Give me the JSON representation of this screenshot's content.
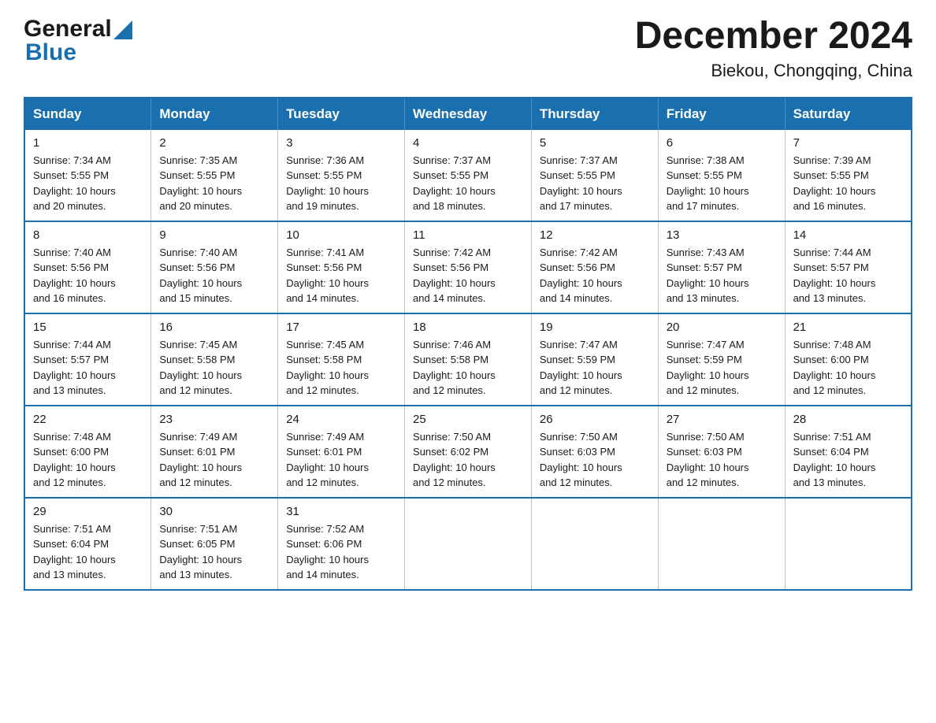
{
  "header": {
    "logo_general": "General",
    "logo_blue": "Blue",
    "month_title": "December 2024",
    "location": "Biekou, Chongqing, China"
  },
  "weekdays": [
    "Sunday",
    "Monday",
    "Tuesday",
    "Wednesday",
    "Thursday",
    "Friday",
    "Saturday"
  ],
  "weeks": [
    [
      {
        "day": "1",
        "sunrise": "7:34 AM",
        "sunset": "5:55 PM",
        "daylight": "10 hours and 20 minutes."
      },
      {
        "day": "2",
        "sunrise": "7:35 AM",
        "sunset": "5:55 PM",
        "daylight": "10 hours and 20 minutes."
      },
      {
        "day": "3",
        "sunrise": "7:36 AM",
        "sunset": "5:55 PM",
        "daylight": "10 hours and 19 minutes."
      },
      {
        "day": "4",
        "sunrise": "7:37 AM",
        "sunset": "5:55 PM",
        "daylight": "10 hours and 18 minutes."
      },
      {
        "day": "5",
        "sunrise": "7:37 AM",
        "sunset": "5:55 PM",
        "daylight": "10 hours and 17 minutes."
      },
      {
        "day": "6",
        "sunrise": "7:38 AM",
        "sunset": "5:55 PM",
        "daylight": "10 hours and 17 minutes."
      },
      {
        "day": "7",
        "sunrise": "7:39 AM",
        "sunset": "5:55 PM",
        "daylight": "10 hours and 16 minutes."
      }
    ],
    [
      {
        "day": "8",
        "sunrise": "7:40 AM",
        "sunset": "5:56 PM",
        "daylight": "10 hours and 16 minutes."
      },
      {
        "day": "9",
        "sunrise": "7:40 AM",
        "sunset": "5:56 PM",
        "daylight": "10 hours and 15 minutes."
      },
      {
        "day": "10",
        "sunrise": "7:41 AM",
        "sunset": "5:56 PM",
        "daylight": "10 hours and 14 minutes."
      },
      {
        "day": "11",
        "sunrise": "7:42 AM",
        "sunset": "5:56 PM",
        "daylight": "10 hours and 14 minutes."
      },
      {
        "day": "12",
        "sunrise": "7:42 AM",
        "sunset": "5:56 PM",
        "daylight": "10 hours and 14 minutes."
      },
      {
        "day": "13",
        "sunrise": "7:43 AM",
        "sunset": "5:57 PM",
        "daylight": "10 hours and 13 minutes."
      },
      {
        "day": "14",
        "sunrise": "7:44 AM",
        "sunset": "5:57 PM",
        "daylight": "10 hours and 13 minutes."
      }
    ],
    [
      {
        "day": "15",
        "sunrise": "7:44 AM",
        "sunset": "5:57 PM",
        "daylight": "10 hours and 13 minutes."
      },
      {
        "day": "16",
        "sunrise": "7:45 AM",
        "sunset": "5:58 PM",
        "daylight": "10 hours and 12 minutes."
      },
      {
        "day": "17",
        "sunrise": "7:45 AM",
        "sunset": "5:58 PM",
        "daylight": "10 hours and 12 minutes."
      },
      {
        "day": "18",
        "sunrise": "7:46 AM",
        "sunset": "5:58 PM",
        "daylight": "10 hours and 12 minutes."
      },
      {
        "day": "19",
        "sunrise": "7:47 AM",
        "sunset": "5:59 PM",
        "daylight": "10 hours and 12 minutes."
      },
      {
        "day": "20",
        "sunrise": "7:47 AM",
        "sunset": "5:59 PM",
        "daylight": "10 hours and 12 minutes."
      },
      {
        "day": "21",
        "sunrise": "7:48 AM",
        "sunset": "6:00 PM",
        "daylight": "10 hours and 12 minutes."
      }
    ],
    [
      {
        "day": "22",
        "sunrise": "7:48 AM",
        "sunset": "6:00 PM",
        "daylight": "10 hours and 12 minutes."
      },
      {
        "day": "23",
        "sunrise": "7:49 AM",
        "sunset": "6:01 PM",
        "daylight": "10 hours and 12 minutes."
      },
      {
        "day": "24",
        "sunrise": "7:49 AM",
        "sunset": "6:01 PM",
        "daylight": "10 hours and 12 minutes."
      },
      {
        "day": "25",
        "sunrise": "7:50 AM",
        "sunset": "6:02 PM",
        "daylight": "10 hours and 12 minutes."
      },
      {
        "day": "26",
        "sunrise": "7:50 AM",
        "sunset": "6:03 PM",
        "daylight": "10 hours and 12 minutes."
      },
      {
        "day": "27",
        "sunrise": "7:50 AM",
        "sunset": "6:03 PM",
        "daylight": "10 hours and 12 minutes."
      },
      {
        "day": "28",
        "sunrise": "7:51 AM",
        "sunset": "6:04 PM",
        "daylight": "10 hours and 13 minutes."
      }
    ],
    [
      {
        "day": "29",
        "sunrise": "7:51 AM",
        "sunset": "6:04 PM",
        "daylight": "10 hours and 13 minutes."
      },
      {
        "day": "30",
        "sunrise": "7:51 AM",
        "sunset": "6:05 PM",
        "daylight": "10 hours and 13 minutes."
      },
      {
        "day": "31",
        "sunrise": "7:52 AM",
        "sunset": "6:06 PM",
        "daylight": "10 hours and 14 minutes."
      },
      null,
      null,
      null,
      null
    ]
  ],
  "labels": {
    "sunrise": "Sunrise:",
    "sunset": "Sunset:",
    "daylight": "Daylight:"
  }
}
